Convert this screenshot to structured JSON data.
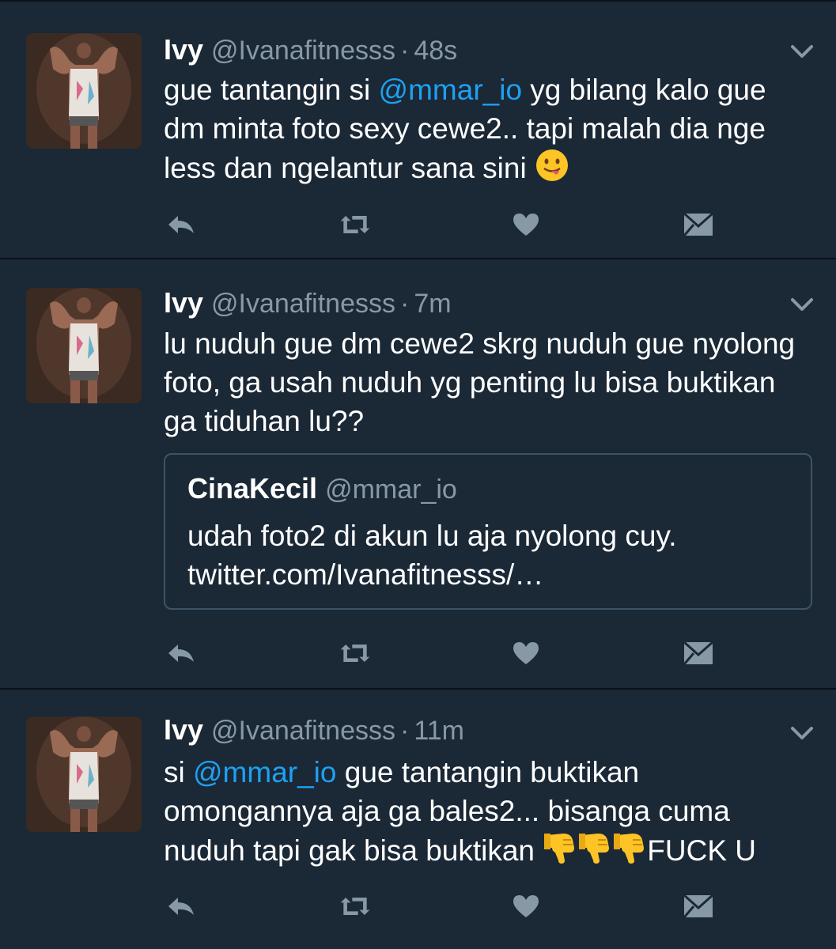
{
  "tweets": [
    {
      "name": "Ivy",
      "handle": "@Ivanafitnesss",
      "separator": "·",
      "time": "48s",
      "text_parts": {
        "p1": "gue tantangin si ",
        "mention": "@mmar_io",
        "p2": " yg bilang kalo gue dm minta foto sexy cewe2.. tapi malah dia nge less dan ngelantur sana sini "
      },
      "emoji": "yum-face-emoji"
    },
    {
      "name": "Ivy",
      "handle": "@Ivanafitnesss",
      "separator": "·",
      "time": "7m",
      "text": "lu nuduh gue dm cewe2 skrg nuduh gue nyolong foto, ga usah nuduh yg penting lu bisa buktikan ga tiduhan lu??",
      "quote": {
        "name": "CinaKecil",
        "handle": "@mmar_io",
        "text_line1": "udah foto2 di akun lu aja nyolong cuy.",
        "text_line2": "twitter.com/Ivanafitnesss/…"
      }
    },
    {
      "name": "Ivy",
      "handle": "@Ivanafitnesss",
      "separator": "·",
      "time": "11m",
      "text_parts": {
        "p1": "si ",
        "mention": "@mmar_io",
        "p2": " gue tantangin buktikan omongannya aja ga bales2... bisanga cuma nuduh tapi gak bisa buktikan ",
        "p3": "FUCK U"
      },
      "emoji": "thumbs-down-emoji"
    }
  ],
  "icons": {
    "reply": "reply-icon",
    "retweet": "retweet-icon",
    "like": "heart-icon",
    "dm": "envelope-icon",
    "menu": "chevron-down-icon"
  },
  "colors": {
    "background": "#1b2836",
    "divider": "#0b1117",
    "mention": "#1da1f2",
    "muted": "#8899a6",
    "icon": "#8899a6",
    "emoji_yellow": "#fdc425"
  }
}
